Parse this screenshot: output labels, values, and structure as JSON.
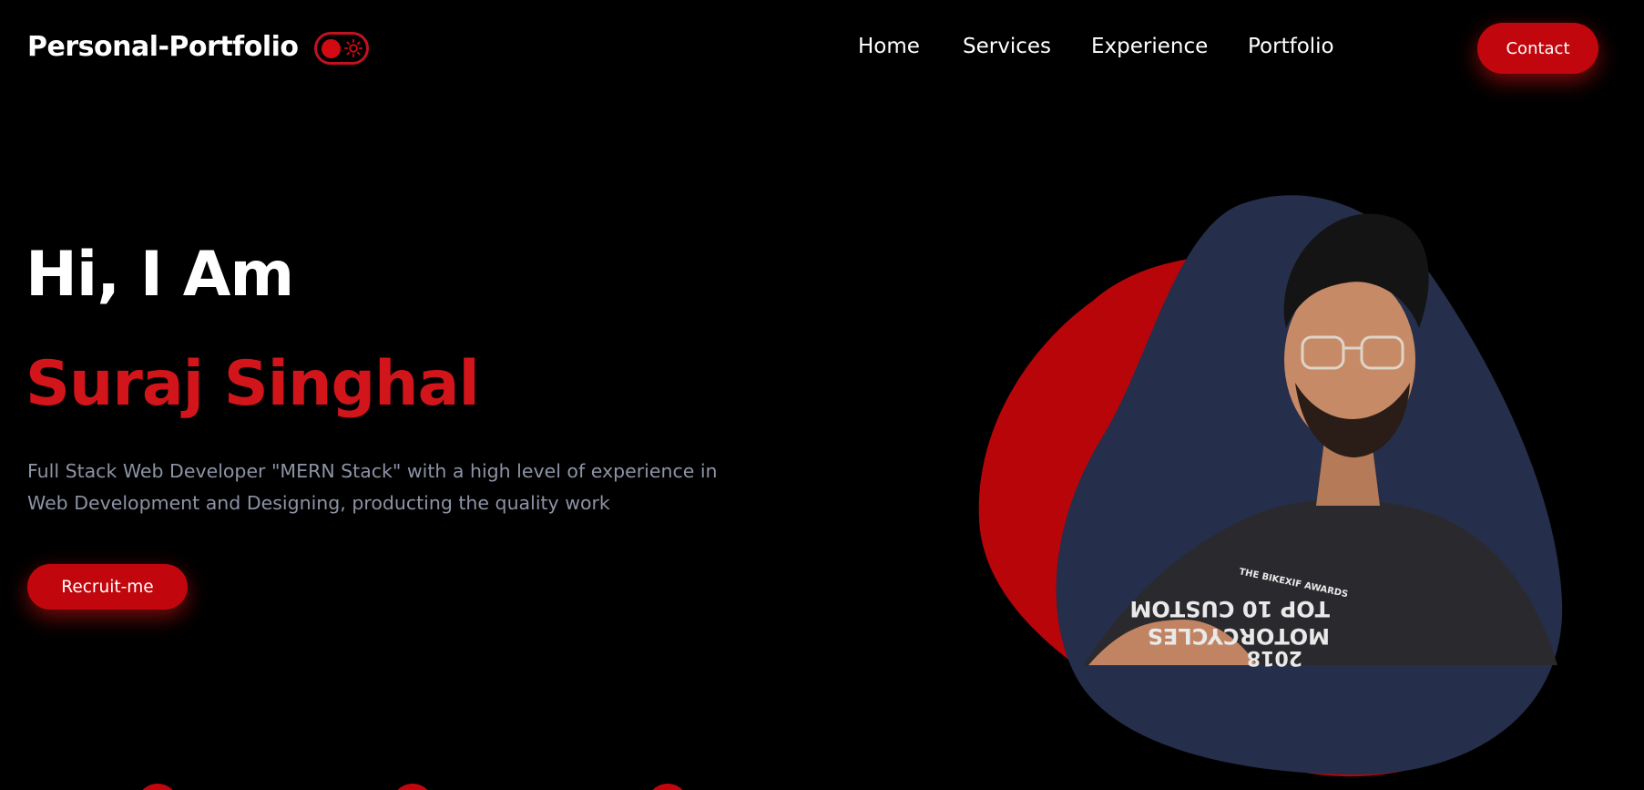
{
  "header": {
    "logo": "Personal-Portfolio",
    "theme_toggle": {
      "icon": "sun-icon",
      "state": "dark"
    },
    "nav": {
      "home": "Home",
      "services": "Services",
      "experience": "Experience",
      "portfolio": "Portfolio"
    },
    "contact_label": "Contact"
  },
  "hero": {
    "greeting": "Hi, I Am",
    "name": "Suraj Singhal",
    "tagline": "Full Stack Web Developer \"MERN Stack\" with a high level of experience in Web Development and Designing, producting the quality work",
    "cta_label": "Recruit-me",
    "photo": {
      "shirt_text_line1": "THE BIKEXIF AWARDS",
      "shirt_text_line2": "TOP 10 CUSTOM",
      "shirt_text_line3": "MOTORCYCLES",
      "shirt_text_line4": "2018"
    }
  },
  "colors": {
    "background": "#000000",
    "accent": "#c1070d",
    "name_red": "#d2151a",
    "blob_navy": "#252e4a",
    "muted_text": "#8d93a6"
  }
}
